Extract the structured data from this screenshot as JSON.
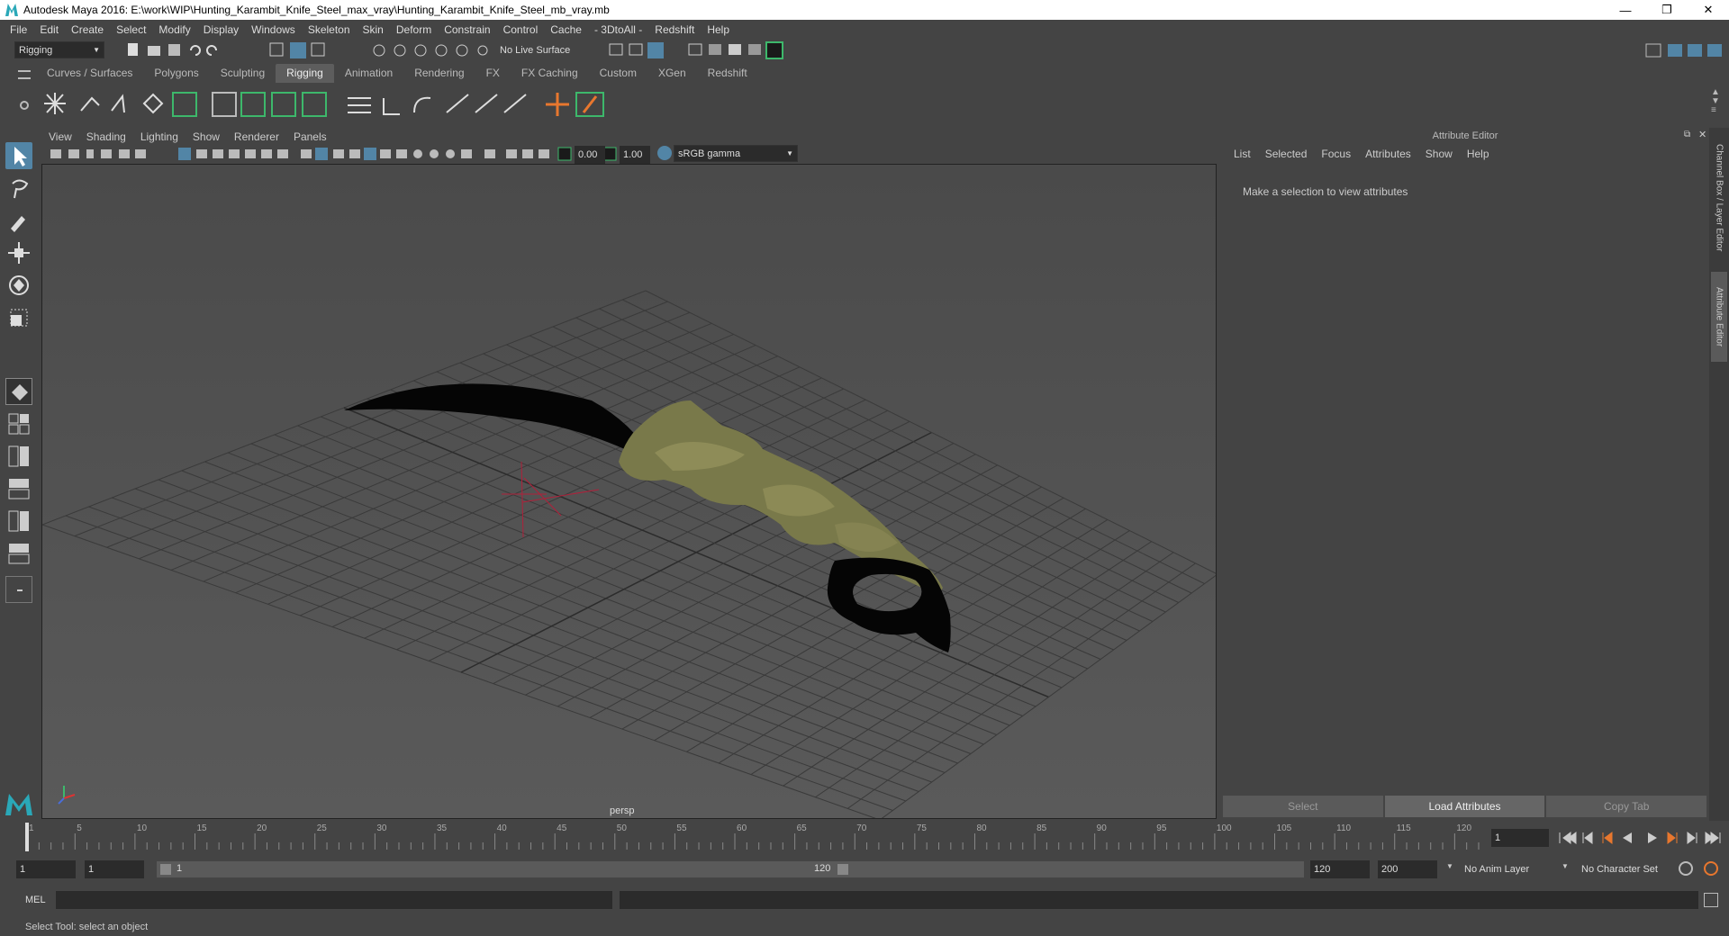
{
  "window": {
    "title": "Autodesk Maya 2016: E:\\work\\WIP\\Hunting_Karambit_Knife_Steel_max_vray\\Hunting_Karambit_Knife_Steel_mb_vray.mb",
    "minimize": "—",
    "maximize": "❐",
    "close": "✕"
  },
  "menubar": [
    "File",
    "Edit",
    "Create",
    "Select",
    "Modify",
    "Display",
    "Windows",
    "Skeleton",
    "Skin",
    "Deform",
    "Constrain",
    "Control",
    "Cache",
    "- 3DtoAll -",
    "Redshift",
    "Help"
  ],
  "toolbar": {
    "mode": "Rigging",
    "live_surface": "No Live Surface"
  },
  "shelf": {
    "tabs": [
      "Curves / Surfaces",
      "Polygons",
      "Sculpting",
      "Rigging",
      "Animation",
      "Rendering",
      "FX",
      "FX Caching",
      "Custom",
      "XGen",
      "Redshift"
    ],
    "active": "Rigging"
  },
  "viewport": {
    "menus": [
      "View",
      "Shading",
      "Lighting",
      "Show",
      "Renderer",
      "Panels"
    ],
    "exposure": "0.00",
    "gamma": "1.00",
    "color_space": "sRGB gamma",
    "camera": "persp"
  },
  "attribute_editor": {
    "header": "Attribute Editor",
    "menus": [
      "List",
      "Selected",
      "Focus",
      "Attributes",
      "Show",
      "Help"
    ],
    "message": "Make a selection to view attributes",
    "buttons": [
      "Select",
      "Load Attributes",
      "Copy Tab"
    ],
    "side_tabs": [
      "Channel Box / Layer Editor",
      "Attribute Editor"
    ]
  },
  "timeline": {
    "ticks": [
      "1",
      "5",
      "10",
      "15",
      "20",
      "25",
      "30",
      "35",
      "40",
      "45",
      "50",
      "55",
      "60",
      "65",
      "70",
      "75",
      "80",
      "85",
      "90",
      "95",
      "100",
      "105",
      "110",
      "115",
      "120"
    ],
    "tick_values": [
      1,
      5,
      10,
      15,
      20,
      25,
      30,
      35,
      40,
      45,
      50,
      55,
      60,
      65,
      70,
      75,
      80,
      85,
      90,
      95,
      100,
      105,
      110,
      115,
      120
    ],
    "current_frame": "1",
    "range_start": "1",
    "range_start_inner": "1",
    "range_slider_start": "1",
    "range_slider_end": "120",
    "range_end": "120",
    "anim_end": "200",
    "anim_layer": "No Anim Layer",
    "character_set": "No Character Set"
  },
  "command": {
    "label": "MEL",
    "help": "Select Tool: select an object"
  }
}
